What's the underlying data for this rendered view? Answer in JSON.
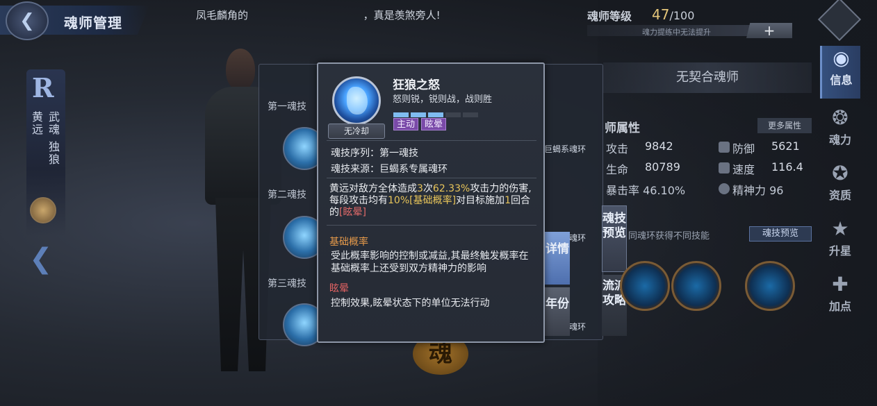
{
  "header": {
    "title": "魂师管理",
    "marquee_left": "凤毛麟角的",
    "marquee_right": "，真是羡煞旁人!",
    "level_label": "魂师等级",
    "level_value": "47",
    "level_max": "/100",
    "level_note": "魂力提练中无法提升",
    "plus_label": "+"
  },
  "right_nav": [
    {
      "label": "信息",
      "icon": "◉",
      "active": true
    },
    {
      "label": "魂力",
      "icon": "❂",
      "active": false
    },
    {
      "label": "资质",
      "icon": "✪",
      "active": false
    },
    {
      "label": "升星",
      "icon": "★",
      "active": false
    },
    {
      "label": "加点",
      "icon": "✚",
      "active": false
    }
  ],
  "left_card": {
    "rank": "R",
    "col1": "武魂 独狼",
    "col2": "黄远"
  },
  "skills_panel": {
    "skill1_label": "第一魂技",
    "skill2_label": "第二魂技",
    "skill3_label": "第三魂技",
    "src1": "巨蝎系魂环",
    "src2": "魂环",
    "src3": "魂环",
    "tab_detail": "详情",
    "tab_year": "年份"
  },
  "info": {
    "no_contract": "无契合魂师",
    "attr_title": "师属性",
    "more_attr": "更多属性",
    "attrs": [
      {
        "label": "攻击",
        "value": "9842"
      },
      {
        "label": "防御",
        "value": "5621"
      },
      {
        "label": "生命",
        "value": "80789"
      },
      {
        "label": "速度",
        "value": "116.4"
      },
      {
        "label": "暴击率",
        "value": "46.10%"
      },
      {
        "label": "精神力",
        "value": "96"
      }
    ],
    "tab_preview": "魂技预览",
    "tab_guide": "流派攻略",
    "preview_hint": "同魂环获得不同技能",
    "preview_btn": "魂技预览",
    "wuhun_char": "魂"
  },
  "popup": {
    "skill_name": "狂狼之怒",
    "motto": "怒则锐，锐则战，战则胜",
    "cooldown": "无冷却",
    "level_filled": 3,
    "level_total": 5,
    "tag_active": "主动",
    "tag_stun": "眩晕",
    "seq_label": "魂技序列：第一魂技",
    "src_label": "魂技来源：巨蝎系专属魂环",
    "desc": {
      "p1": "黄远对敌方全体造成",
      "n1": "3",
      "p2": "次",
      "n2": "62.33%",
      "p3": "攻击力的伤害,每段攻击均有",
      "n3": "10%",
      "k1": "[基础概率]",
      "p4": "对目标施加",
      "n4": "1",
      "p5": "回合的",
      "k2": "[眩晕]"
    },
    "term1_title": "基础概率",
    "term1_body": "受此概率影响的控制或减益,其最终触发概率在基础概率上还受到双方精神力的影响",
    "term2_title": "眩晕",
    "term2_body": "控制效果,眩晕状态下的单位无法行动"
  }
}
